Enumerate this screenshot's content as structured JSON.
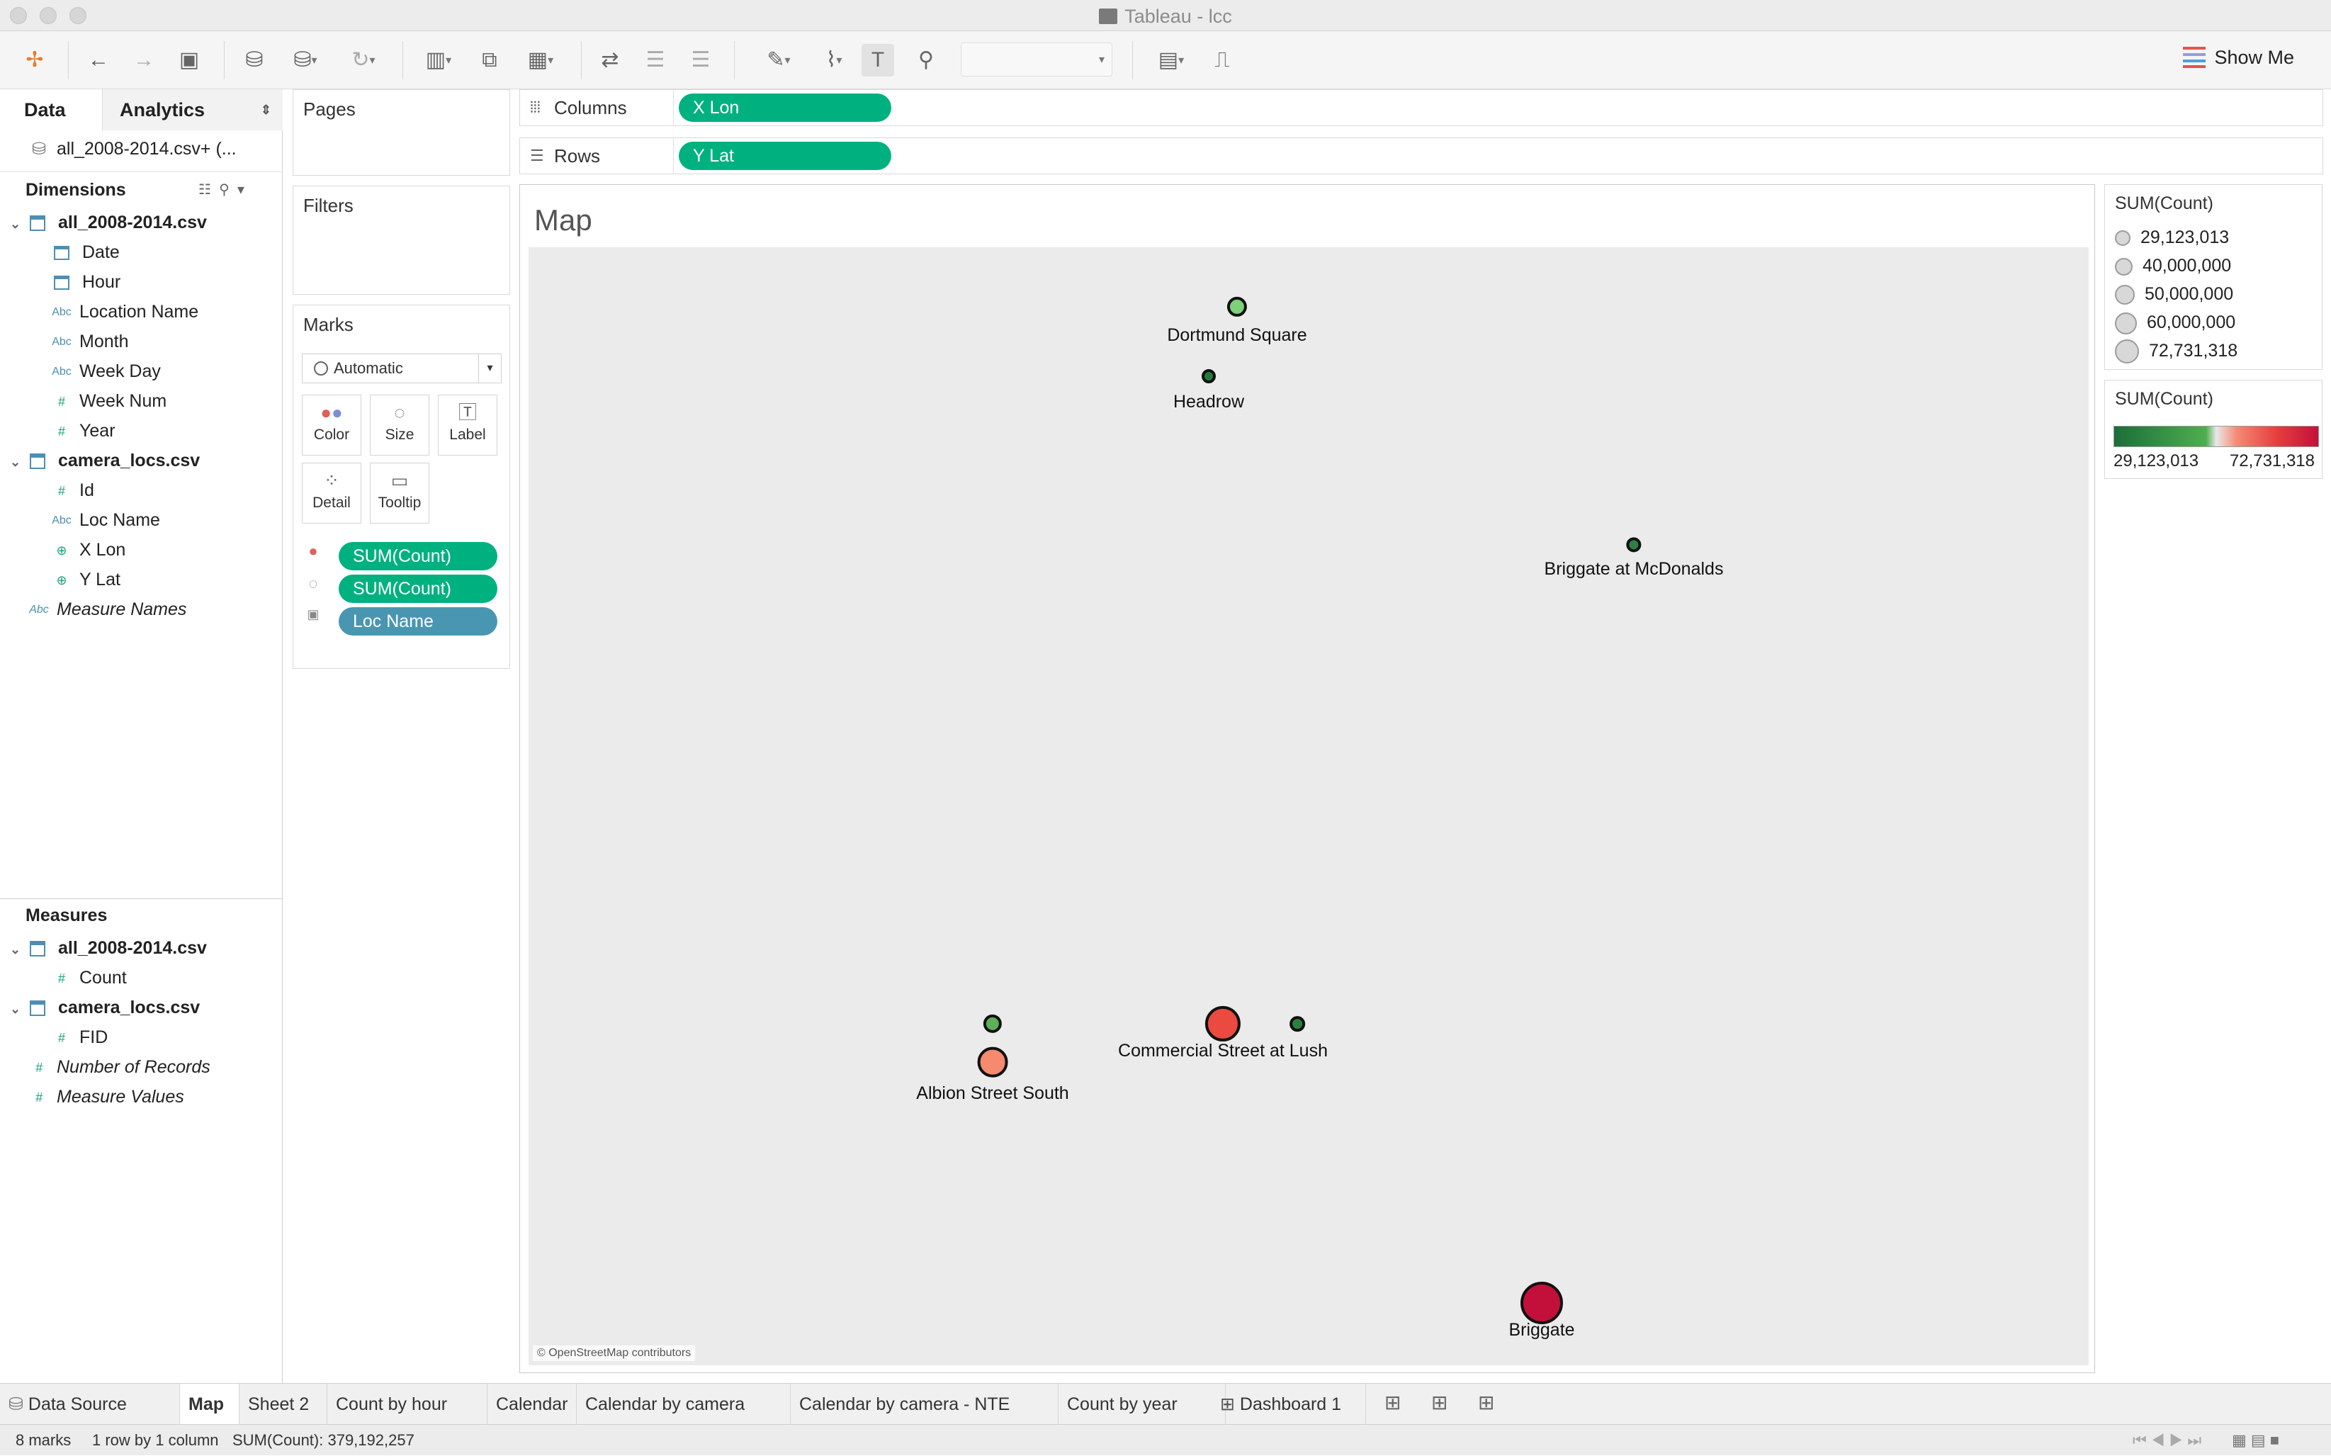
{
  "window": {
    "title": "Tableau - lcc"
  },
  "toolbar": {
    "show_me": "Show Me"
  },
  "left_panel": {
    "tabs": [
      "Data",
      "Analytics"
    ],
    "datasource": "all_2008-2014.csv+ (...",
    "dimensions_header": "Dimensions",
    "measures_header": "Measures",
    "dim_tables": [
      {
        "name": "all_2008-2014.csv",
        "fields": [
          {
            "type": "date",
            "name": "Date"
          },
          {
            "type": "date",
            "name": "Hour"
          },
          {
            "type": "Abc",
            "name": "Location Name"
          },
          {
            "type": "Abc",
            "name": "Month"
          },
          {
            "type": "Abc",
            "name": "Week Day"
          },
          {
            "type": "#",
            "name": "Week Num"
          },
          {
            "type": "#",
            "name": "Year"
          }
        ]
      },
      {
        "name": "camera_locs.csv",
        "fields": [
          {
            "type": "#",
            "name": "Id"
          },
          {
            "type": "Abc",
            "name": "Loc Name"
          },
          {
            "type": "geo",
            "name": "X Lon"
          },
          {
            "type": "geo",
            "name": "Y Lat"
          }
        ]
      }
    ],
    "measure_names": "Measure Names",
    "meas_tables": [
      {
        "name": "all_2008-2014.csv",
        "fields": [
          {
            "type": "#",
            "name": "Count"
          }
        ]
      },
      {
        "name": "camera_locs.csv",
        "fields": [
          {
            "type": "#",
            "name": "FID"
          }
        ]
      }
    ],
    "number_of_records": "Number of Records",
    "measure_values": "Measure Values"
  },
  "pages": {
    "title": "Pages"
  },
  "filters": {
    "title": "Filters"
  },
  "marks": {
    "title": "Marks",
    "type": "Automatic",
    "buttons": [
      "Color",
      "Size",
      "Label",
      "Detail",
      "Tooltip"
    ],
    "pills": [
      {
        "icon": "color-icon",
        "label": "SUM(Count)"
      },
      {
        "icon": "size-icon",
        "label": "SUM(Count)"
      },
      {
        "icon": "label-icon",
        "label": "Loc Name"
      }
    ]
  },
  "shelves": {
    "columns_label": "Columns",
    "columns_pill": "X Lon",
    "rows_label": "Rows",
    "rows_pill": "Y Lat"
  },
  "view": {
    "title": "Map",
    "attribution": "© OpenStreetMap contributors",
    "marks": [
      {
        "label": "Dortmund Square",
        "sum_count": 38000000,
        "color": "#7ed07a"
      },
      {
        "label": "Headrow",
        "sum_count": 29123013,
        "color": "#237a3e"
      },
      {
        "label": "Briggate at McDonalds",
        "sum_count": 30500000,
        "color": "#2f7f45"
      },
      {
        "label": "",
        "sum_count": 36000000,
        "color": "#5fae59"
      },
      {
        "label": "Albion Street South",
        "sum_count": 54000000,
        "color": "#f58a6e"
      },
      {
        "label": "Commercial Street at Lush",
        "sum_count": 62000000,
        "color": "#ea4a3f"
      },
      {
        "label": "",
        "sum_count": 31000000,
        "color": "#2c8040"
      },
      {
        "label": "Briggate",
        "sum_count": 72731318,
        "color": "#c3103a"
      }
    ]
  },
  "size_legend": {
    "title": "SUM(Count)",
    "items": [
      "29,123,013",
      "40,000,000",
      "50,000,000",
      "60,000,000",
      "72,731,318"
    ]
  },
  "color_legend": {
    "title": "SUM(Count)",
    "min": "29,123,013",
    "max": "72,731,318"
  },
  "sheet_tabs": [
    "Data Source",
    "Map",
    "Sheet 2",
    "Count by hour",
    "Calendar",
    "Calendar by camera",
    "Calendar by camera - NTE",
    "Count by year",
    "Dashboard 1"
  ],
  "status": {
    "marks": "8 marks",
    "rows": "1 row by 1 column",
    "sum": "SUM(Count): 379,192,257"
  }
}
